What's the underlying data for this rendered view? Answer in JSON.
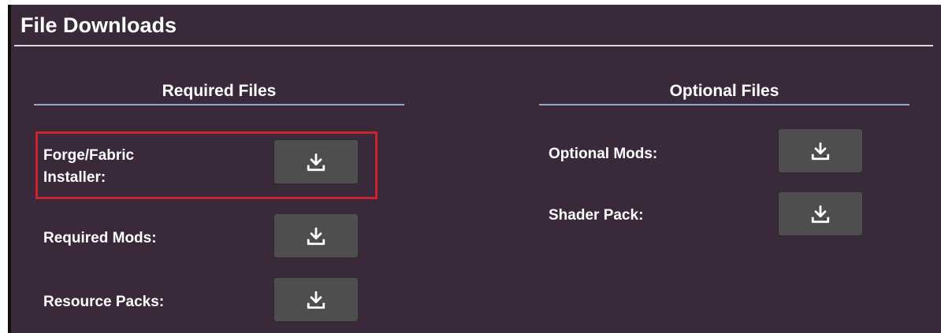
{
  "panel": {
    "title": "File Downloads"
  },
  "required": {
    "heading": "Required Files",
    "items": [
      {
        "label_line1": "Forge/Fabric",
        "label_line2": "Installer:",
        "button_icon": "download-icon"
      },
      {
        "label": "Required Mods:",
        "button_icon": "download-icon"
      },
      {
        "label": "Resource Packs:",
        "button_icon": "download-icon"
      }
    ]
  },
  "optional": {
    "heading": "Optional Files",
    "items": [
      {
        "label": "Optional Mods:",
        "button_icon": "download-icon"
      },
      {
        "label": "Shader Pack:",
        "button_icon": "download-icon"
      }
    ]
  },
  "colors": {
    "panel_background": "#3a293b",
    "button_background": "#4e4e4e",
    "section_rule": "#93acc6",
    "highlight": "#d0222a"
  }
}
